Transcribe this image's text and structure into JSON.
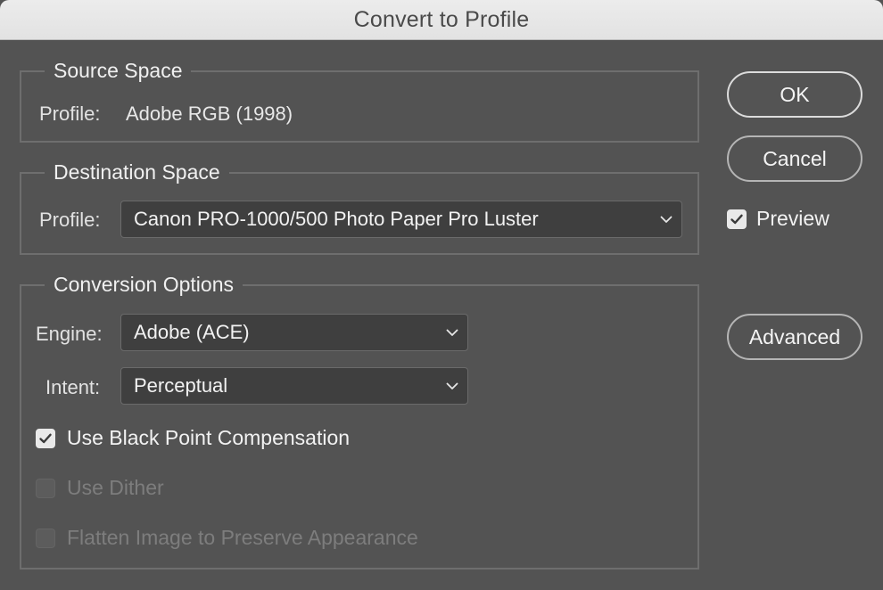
{
  "window": {
    "title": "Convert to Profile"
  },
  "source_space": {
    "legend": "Source Space",
    "profile_label": "Profile:",
    "profile_value": "Adobe RGB (1998)"
  },
  "destination_space": {
    "legend": "Destination Space",
    "profile_label": "Profile:",
    "profile_selected": "Canon PRO-1000/500 Photo Paper Pro Luster"
  },
  "conversion_options": {
    "legend": "Conversion Options",
    "engine_label": "Engine:",
    "engine_selected": "Adobe (ACE)",
    "intent_label": "Intent:",
    "intent_selected": "Perceptual",
    "black_point": {
      "label": "Use Black Point Compensation",
      "checked": true,
      "enabled": true
    },
    "dither": {
      "label": "Use Dither",
      "checked": false,
      "enabled": false
    },
    "flatten": {
      "label": "Flatten Image to Preserve Appearance",
      "checked": false,
      "enabled": false
    }
  },
  "buttons": {
    "ok": "OK",
    "cancel": "Cancel",
    "advanced": "Advanced"
  },
  "preview": {
    "label": "Preview",
    "checked": true
  },
  "icons": {
    "checkmark": "checkmark-icon",
    "chevron": "chevron-down-icon"
  }
}
